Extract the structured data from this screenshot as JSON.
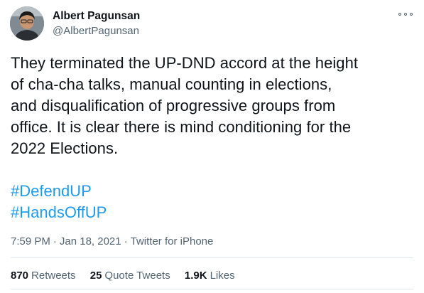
{
  "author": {
    "display_name": "Albert Pagunsan",
    "handle": "@AlbertPagunsan"
  },
  "tweet": {
    "text_lines": [
      "They terminated the UP-DND accord at the height",
      "of cha-cha talks, manual counting in elections,",
      "and disqualification of progressive groups from",
      "office. It is clear there is mind conditioning for the",
      "2022 Elections."
    ],
    "hashtags": [
      "#DefendUP",
      "#HandsOffUP"
    ]
  },
  "meta": {
    "time": "7:59 PM",
    "separator": "·",
    "date": "Jan 18, 2021",
    "source": "Twitter for iPhone"
  },
  "stats": {
    "retweets_count": "870",
    "retweets_label": "Retweets",
    "quotes_count": "25",
    "quotes_label": "Quote Tweets",
    "likes_count": "1.9K",
    "likes_label": "Likes"
  },
  "colors": {
    "link": "#1d9bf0",
    "muted": "#536471",
    "text": "#0f1419"
  },
  "icons": {
    "more": "more-icon",
    "avatar": "avatar"
  }
}
